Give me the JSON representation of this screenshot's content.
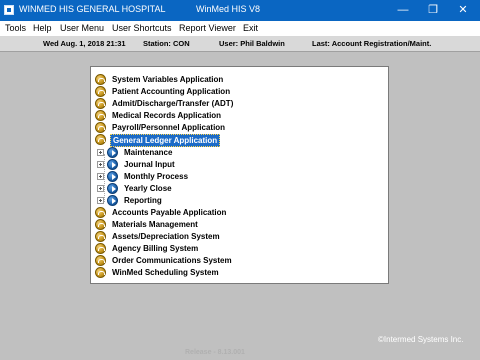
{
  "window": {
    "title_left": "WINMED HIS GENERAL HOSPITAL",
    "title_center": "WinMed HIS V8",
    "controls": {
      "minimize": "—",
      "maximize": "❐",
      "close": "✕"
    }
  },
  "menu": [
    "Tools",
    "Help",
    "User Menu",
    "User Shortcuts",
    "Report Viewer",
    "Exit"
  ],
  "status": {
    "datetime": "Wed Aug.  1, 2018 21:31",
    "station": "Station: CON",
    "user": "User: Phil Baldwin",
    "last": "Last: Account Registration/Maint."
  },
  "tree": {
    "before": [
      "System Variables Application",
      "Patient Accounting Application",
      "Admit/Discharge/Transfer (ADT)",
      "Medical Records Application",
      "Payroll/Personnel Application"
    ],
    "selected": "General Ledger Application",
    "children": [
      "Maintenance",
      "Journal Input",
      "Monthly Process",
      "Yearly Close",
      "Reporting"
    ],
    "after": [
      "Accounts Payable Application",
      "Materials Management",
      "Assets/Depreciation System",
      "Agency Billing System",
      "Order Communications System",
      "WinMed Scheduling System"
    ]
  },
  "footer": {
    "copyright": "©Intermed Systems Inc.",
    "release": "Release - 8.13.001"
  },
  "colors": {
    "titlebar": "#0a66c2",
    "selection": "#1c6bc7",
    "background": "#c0c0c0"
  }
}
